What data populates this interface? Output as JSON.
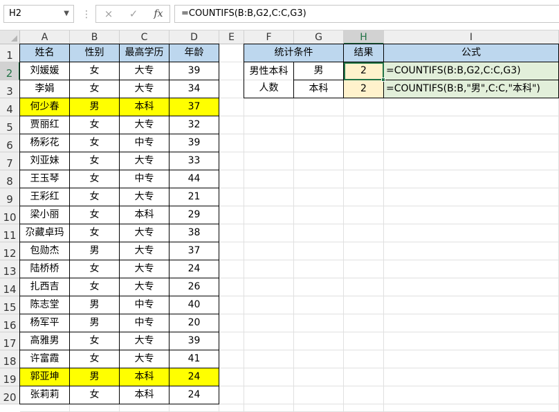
{
  "formula_bar": {
    "name_box": "H2",
    "formula": "=COUNTIFS(B:B,G2,C:C,G3)",
    "cancel_icon": "×",
    "confirm_icon": "✓",
    "fx_label": "fx"
  },
  "columns": [
    "A",
    "B",
    "C",
    "D",
    "E",
    "F",
    "G",
    "H",
    "I"
  ],
  "rows": [
    "1",
    "2",
    "3",
    "4",
    "5",
    "6",
    "7",
    "8",
    "9",
    "10",
    "11",
    "12",
    "13",
    "14",
    "15",
    "16",
    "17",
    "18",
    "19",
    "20"
  ],
  "left_table": {
    "headers": [
      "姓名",
      "性别",
      "最高学历",
      "年龄"
    ],
    "records": [
      {
        "name": "刘媛媛",
        "gender": "女",
        "edu": "大专",
        "age": "39"
      },
      {
        "name": "李娟",
        "gender": "女",
        "edu": "大专",
        "age": "34"
      },
      {
        "name": "何少春",
        "gender": "男",
        "edu": "本科",
        "age": "37"
      },
      {
        "name": "贾丽红",
        "gender": "女",
        "edu": "大专",
        "age": "32"
      },
      {
        "name": "杨彩花",
        "gender": "女",
        "edu": "中专",
        "age": "39"
      },
      {
        "name": "刘亚妹",
        "gender": "女",
        "edu": "大专",
        "age": "33"
      },
      {
        "name": "王玉琴",
        "gender": "女",
        "edu": "中专",
        "age": "44"
      },
      {
        "name": "王彩红",
        "gender": "女",
        "edu": "大专",
        "age": "21"
      },
      {
        "name": "梁小丽",
        "gender": "女",
        "edu": "本科",
        "age": "29"
      },
      {
        "name": "尕藏卓玛",
        "gender": "女",
        "edu": "大专",
        "age": "38"
      },
      {
        "name": "包勋杰",
        "gender": "男",
        "edu": "大专",
        "age": "37"
      },
      {
        "name": "陆桥桥",
        "gender": "女",
        "edu": "大专",
        "age": "24"
      },
      {
        "name": "扎西吉",
        "gender": "女",
        "edu": "大专",
        "age": "26"
      },
      {
        "name": "陈志堂",
        "gender": "男",
        "edu": "中专",
        "age": "40"
      },
      {
        "name": "杨军平",
        "gender": "男",
        "edu": "中专",
        "age": "20"
      },
      {
        "name": "高雅男",
        "gender": "女",
        "edu": "大专",
        "age": "39"
      },
      {
        "name": "许富霞",
        "gender": "女",
        "edu": "大专",
        "age": "41"
      },
      {
        "name": "郭亚坤",
        "gender": "男",
        "edu": "本科",
        "age": "24"
      },
      {
        "name": "张莉莉",
        "gender": "女",
        "edu": "本科",
        "age": "24"
      }
    ],
    "highlight_fill": "#ffff00"
  },
  "right_table": {
    "headers": [
      "统计条件",
      "结果",
      "公式"
    ],
    "condition_label": "男性本科人数",
    "criteria": [
      "男",
      "本科"
    ],
    "results": [
      "2",
      "2"
    ],
    "formulas": [
      "=COUNTIFS(B:B,G2,C:C,G3)",
      "=COUNTIFS(B:B,\"男\",C:C,\"本科\")"
    ]
  },
  "colors": {
    "header_fill": "#bdd7ee",
    "result_fill": "#fff2cc",
    "formula_fill": "#e2efda",
    "selection_accent": "#217346"
  }
}
